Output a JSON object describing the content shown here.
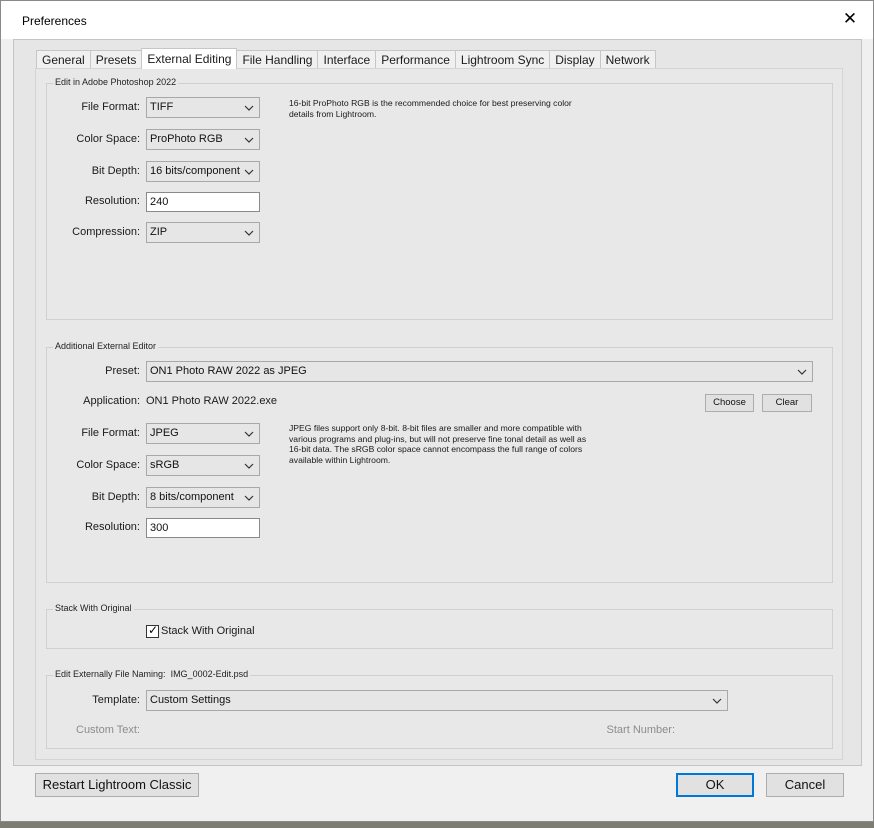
{
  "window": {
    "title": "Preferences"
  },
  "tabs": [
    {
      "label": "General",
      "active": false
    },
    {
      "label": "Presets",
      "active": false
    },
    {
      "label": "External Editing",
      "active": true
    },
    {
      "label": "File Handling",
      "active": false
    },
    {
      "label": "Interface",
      "active": false
    },
    {
      "label": "Performance",
      "active": false
    },
    {
      "label": "Lightroom Sync",
      "active": false
    },
    {
      "label": "Display",
      "active": false
    },
    {
      "label": "Network",
      "active": false
    }
  ],
  "photoshop": {
    "legend": "Edit in Adobe Photoshop 2022",
    "file_format_label": "File Format:",
    "file_format": "TIFF",
    "color_space_label": "Color Space:",
    "color_space": "ProPhoto RGB",
    "bit_depth_label": "Bit Depth:",
    "bit_depth": "16 bits/component",
    "resolution_label": "Resolution:",
    "resolution": "240",
    "compression_label": "Compression:",
    "compression": "ZIP",
    "note": "16-bit ProPhoto RGB is the recommended choice for best preserving color details from Lightroom."
  },
  "additional": {
    "legend": "Additional External Editor",
    "preset_label": "Preset:",
    "preset": "ON1 Photo RAW 2022 as JPEG",
    "application_label": "Application:",
    "application": "ON1 Photo RAW 2022.exe",
    "choose_label": "Choose",
    "clear_label": "Clear",
    "file_format_label": "File Format:",
    "file_format": "JPEG",
    "color_space_label": "Color Space:",
    "color_space": "sRGB",
    "bit_depth_label": "Bit Depth:",
    "bit_depth": "8 bits/component",
    "resolution_label": "Resolution:",
    "resolution": "300",
    "note": "JPEG files support only 8-bit. 8-bit files are smaller and more compatible with various programs and plug-ins, but will not preserve fine tonal detail as well as 16-bit data. The sRGB color space cannot encompass the full range of colors available within Lightroom."
  },
  "stack": {
    "legend": "Stack With Original",
    "checkbox_label": "Stack With Original",
    "checked": true
  },
  "naming": {
    "legend": "Edit Externally File Naming:",
    "example": "IMG_0002-Edit.psd",
    "template_label": "Template:",
    "template": "Custom Settings",
    "custom_text_label": "Custom Text:",
    "start_number_label": "Start Number:"
  },
  "footer": {
    "restart_label": "Restart Lightroom Classic",
    "ok_label": "OK",
    "cancel_label": "Cancel"
  },
  "colors": {
    "accent": "#0078d7"
  }
}
